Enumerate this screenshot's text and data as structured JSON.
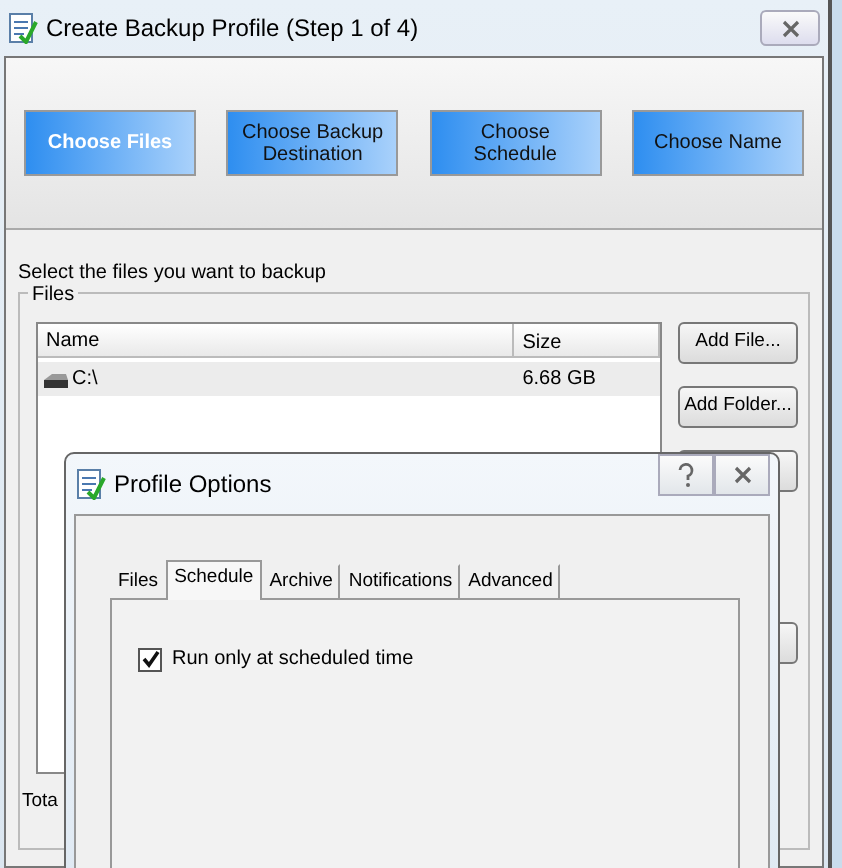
{
  "window": {
    "title": "Create Backup Profile (Step 1 of 4)"
  },
  "steps": [
    {
      "label": "Choose Files",
      "selected": true
    },
    {
      "label": "Choose Backup Destination",
      "selected": false
    },
    {
      "label": "Choose Schedule",
      "selected": false
    },
    {
      "label": "Choose Name",
      "selected": false
    }
  ],
  "instruction": "Select the files you want to backup",
  "files_group": {
    "legend": "Files",
    "columns": [
      "Name",
      "Size"
    ],
    "rows": [
      {
        "name": "C:\\",
        "size": "6.68 GB",
        "selected": true
      }
    ],
    "buttons": [
      "Add File...",
      "Add Folder..."
    ],
    "total_label": "Tota"
  },
  "dialog": {
    "title": "Profile Options",
    "tabs": [
      {
        "label": "Files",
        "selected": false
      },
      {
        "label": "Schedule",
        "selected": true
      },
      {
        "label": "Archive",
        "selected": false
      },
      {
        "label": "Notifications",
        "selected": false
      },
      {
        "label": "Advanced",
        "selected": false
      }
    ],
    "options": [
      {
        "label": "Run only at scheduled time",
        "checked": true
      }
    ]
  }
}
